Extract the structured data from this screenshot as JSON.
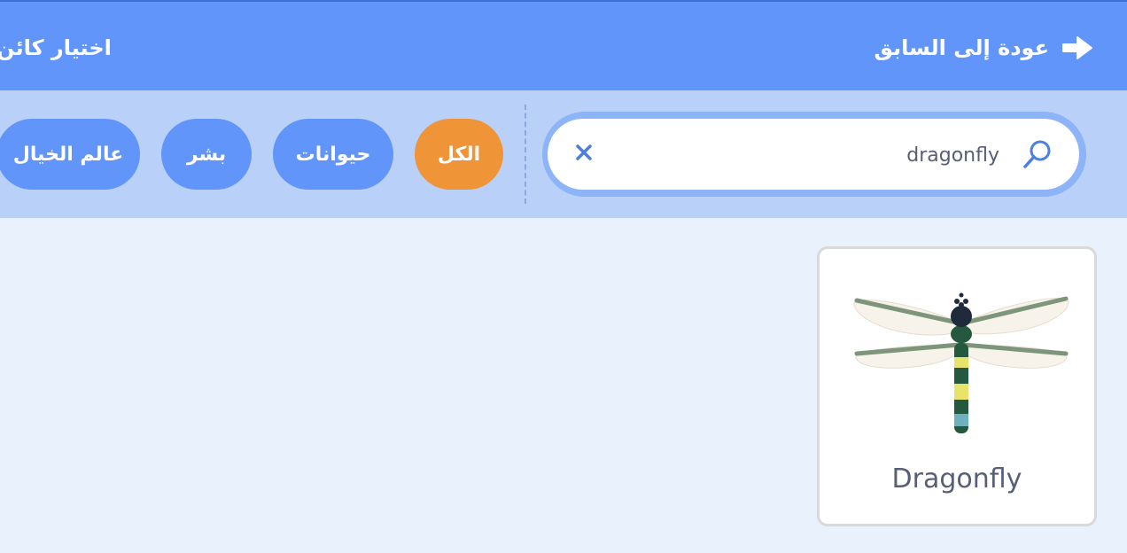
{
  "header": {
    "back_label": "عودة إلى السابق",
    "title": "اختيار كائن"
  },
  "search": {
    "value": "dragonfly",
    "placeholder": ""
  },
  "tags": {
    "all": "الكل",
    "animals": "حيوانات",
    "people": "بشر",
    "fantasy": "عالم الخيال"
  },
  "results": [
    {
      "name": "Dragonfly",
      "icon": "dragonfly-image"
    }
  ],
  "colors": {
    "header": "#6195fa",
    "filter_bar": "#b9d1f8",
    "active_tag": "#f09438",
    "background": "#e9f1fc"
  }
}
